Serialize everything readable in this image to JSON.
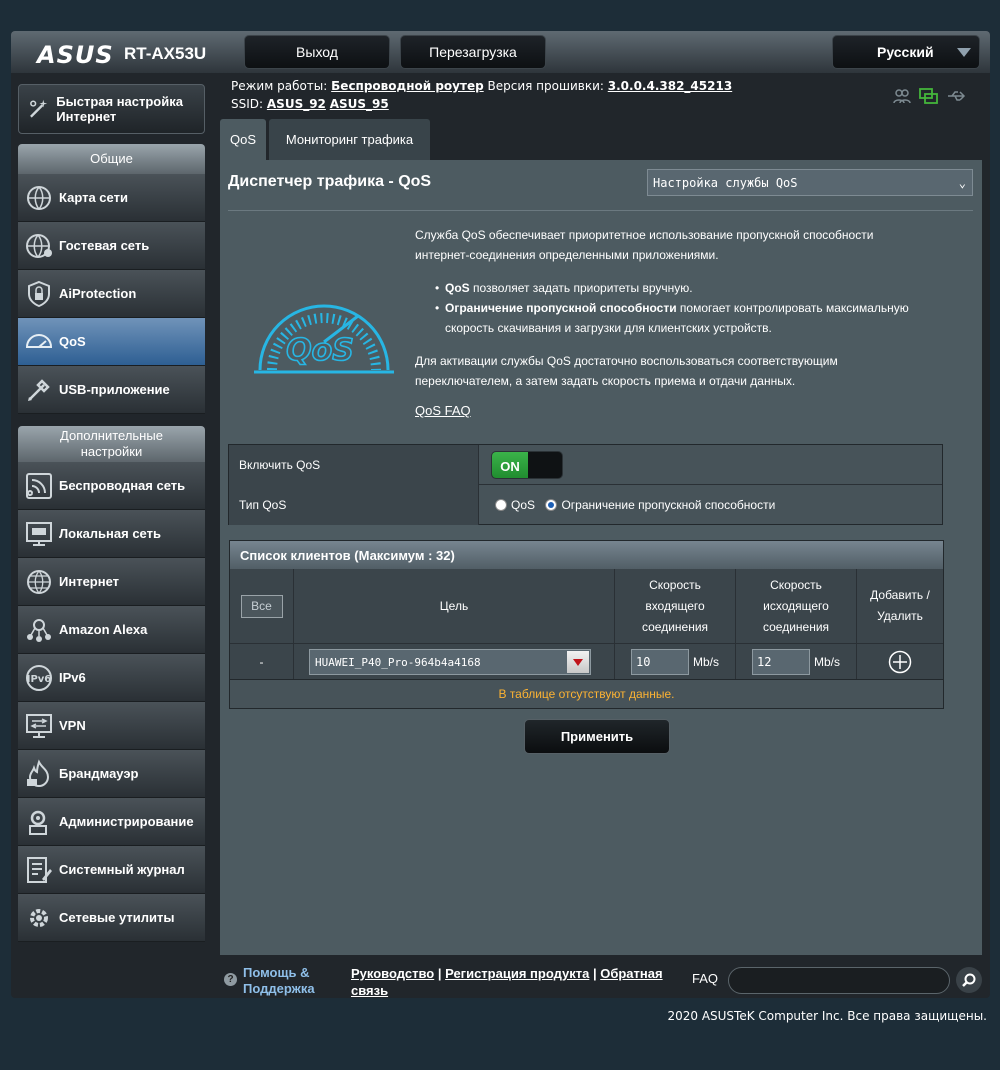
{
  "header": {
    "brand": "ASUS",
    "model": "RT-AX53U",
    "logout_label": "Выход",
    "reboot_label": "Перезагрузка",
    "language": "Русский"
  },
  "info": {
    "mode_label": "Режим работы:",
    "mode_value": "Беспроводной роутер",
    "firmware_label": "Версия прошивки:",
    "firmware_value": "3.0.0.4.382_45213",
    "ssid_label": "SSID:",
    "ssid_1": "ASUS_92",
    "ssid_2": "ASUS_95"
  },
  "sidebar": {
    "quick_setup": "Быстрая настройка Интернет",
    "general_header": "Общие",
    "general_items": [
      {
        "label": "Карта сети",
        "icon": "network-map-icon"
      },
      {
        "label": "Гостевая сеть",
        "icon": "guest-network-icon"
      },
      {
        "label": "AiProtection",
        "icon": "aiprotection-icon"
      },
      {
        "label": "QoS",
        "icon": "qos-icon",
        "active": true
      },
      {
        "label": "USB-приложение",
        "icon": "usb-app-icon"
      }
    ],
    "advanced_header": "Дополнительные настройки",
    "advanced_items": [
      {
        "label": "Беспроводная сеть",
        "icon": "wireless-icon"
      },
      {
        "label": "Локальная сеть",
        "icon": "lan-icon"
      },
      {
        "label": "Интернет",
        "icon": "wan-icon"
      },
      {
        "label": "Amazon Alexa",
        "icon": "alexa-icon"
      },
      {
        "label": "IPv6",
        "icon": "ipv6-icon"
      },
      {
        "label": "VPN",
        "icon": "vpn-icon"
      },
      {
        "label": "Брандмауэр",
        "icon": "firewall-icon"
      },
      {
        "label": "Администрирование",
        "icon": "admin-icon"
      },
      {
        "label": "Системный журнал",
        "icon": "syslog-icon"
      },
      {
        "label": "Сетевые утилиты",
        "icon": "tools-icon"
      }
    ]
  },
  "tabs": [
    "QoS",
    "Мониторинг трафика"
  ],
  "main": {
    "title": "Диспетчер трафика - QoS",
    "service_select": "Настройка службы QoS",
    "desc_1": "Служба QoS обеспечивает приоритетное использование пропускной способности интернет-соединения определенными приложениями.",
    "bullet_1_bold": "QoS",
    "bullet_1_rest": " позволяет задать приоритеты вручную.",
    "bullet_2_bold": "Ограничение пропускной способности",
    "bullet_2_rest": " помогает контролировать максимальную скорость скачивания и загрузки для клиентских устройств.",
    "desc_2": "Для активации службы QoS достаточно воспользоваться соответствующим переключателем, а затем задать скорость приема и отдачи данных.",
    "faq_link": "QoS FAQ",
    "logo_text": "QoS",
    "enable_label": "Включить QoS",
    "enable_state": "ON",
    "type_label": "Тип QoS",
    "type_options": [
      "QoS",
      "Ограничение пропускной способности"
    ],
    "type_selected": "Ограничение пропускной способности",
    "client_list_title": "Список клиентов (Максимум : 32)",
    "col_target": "Цель",
    "col_download": "Скорость входящего соединения",
    "col_upload": "Скорость исходящего соединения",
    "col_add": "Добавить / Удалить",
    "all_button": "Все",
    "row_dash": "-",
    "device": "HUAWEI_P40_Pro-964b4a4168",
    "download_value": "10",
    "upload_value": "12",
    "unit": "Mb/s",
    "empty_msg": "В таблице отсутствуют данные.",
    "apply_label": "Применить"
  },
  "footer": {
    "help": "Помощь & Поддержка",
    "manual": "Руководство",
    "register": "Регистрация продукта",
    "feedback": "Обратная связь",
    "faq_label": "FAQ",
    "copyright": "2020 ASUSTeK Computer Inc. Все права защищены."
  }
}
